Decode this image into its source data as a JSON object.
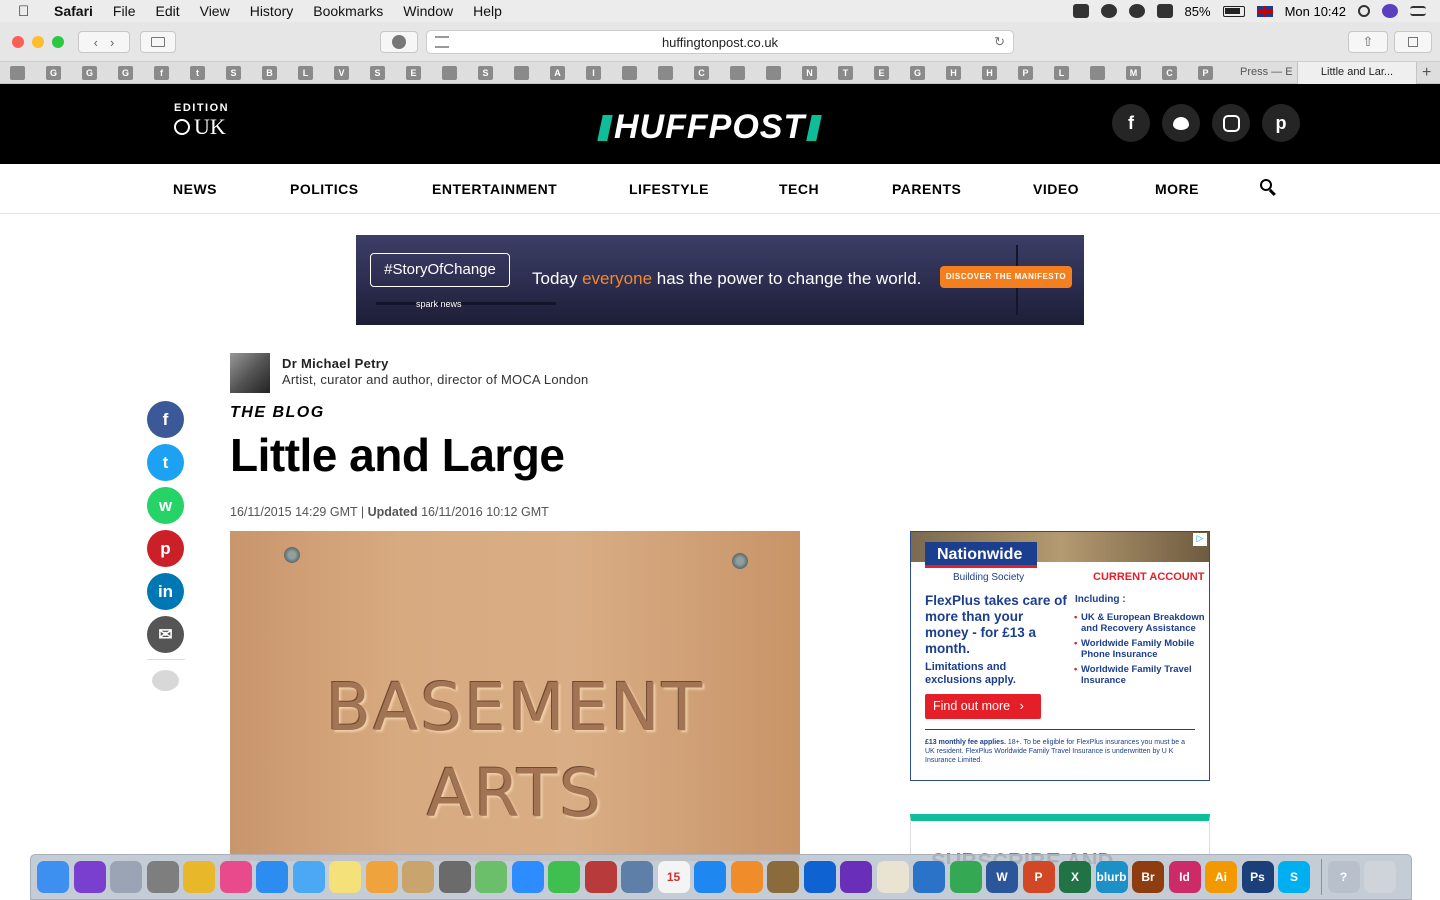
{
  "menubar": {
    "apple": "",
    "app": "Safari",
    "items": [
      "File",
      "Edit",
      "View",
      "History",
      "Bookmarks",
      "Window",
      "Help"
    ],
    "battery": "85%",
    "clock": "Mon 10:42"
  },
  "browser": {
    "url": "huffingtonpost.co.uk",
    "favorites": [
      "",
      "G",
      "G",
      "G",
      "f",
      "t",
      "S",
      "B",
      "L",
      "V",
      "S",
      "E",
      "",
      "S",
      "",
      "A",
      "I",
      "",
      "",
      "C",
      "",
      "",
      "N",
      "T",
      "E",
      "G",
      "H",
      "H",
      "P",
      "L",
      "",
      "M",
      "C",
      "P"
    ],
    "tabs": [
      {
        "label": "Press — E",
        "active": false
      },
      {
        "label": "Little and Lar...",
        "active": true
      }
    ],
    "new_tab": "+"
  },
  "site": {
    "edition_label": "EDITION",
    "edition_region": "UK",
    "logo": "HUFFPOST",
    "social": [
      "f",
      "t",
      "ig",
      "p"
    ],
    "nav": [
      "NEWS",
      "POLITICS",
      "ENTERTAINMENT",
      "LIFESTYLE",
      "TECH",
      "PARENTS",
      "VIDEO",
      "MORE"
    ]
  },
  "banner_ad": {
    "hashtag": "#StoryOfChange",
    "sponsor": "spark news",
    "headline_before": "Today ",
    "headline_highlight": "everyone",
    "headline_after": " has the power to change the world.",
    "cta": "DISCOVER THE MANIFESTO"
  },
  "article": {
    "author_name": "Dr Michael Petry",
    "author_bio": "Artist, curator and author, director of MOCA London",
    "section": "THE BLOG",
    "title": "Little and Large",
    "published": "16/11/2015 14:29 GMT",
    "separator": "|",
    "updated_label": "Updated",
    "updated": "16/11/2016 10:12 GMT",
    "image_text_line1": "BASEMENT",
    "image_text_line2": "ARTS"
  },
  "share_rail": [
    {
      "name": "facebook",
      "glyph": "f",
      "color": "#3b5998"
    },
    {
      "name": "twitter",
      "glyph": "t",
      "color": "#1da1f2"
    },
    {
      "name": "whatsapp",
      "glyph": "w",
      "color": "#25d366"
    },
    {
      "name": "pinterest",
      "glyph": "p",
      "color": "#cb2027"
    },
    {
      "name": "linkedin",
      "glyph": "in",
      "color": "#0077b5"
    },
    {
      "name": "email",
      "glyph": "✉",
      "color": "#555555"
    }
  ],
  "side_ad": {
    "brand": "Nationwide",
    "brand_sub": "Building Society",
    "product": "CURRENT ACCOUNT",
    "offer": "FlexPlus takes care of more than your money - for £13 a month.",
    "limits": "Limitations and exclusions apply.",
    "including": "Including :",
    "benefits": [
      "UK & European Breakdown and Recovery Assistance",
      "Worldwide Family Mobile Phone Insurance",
      "Worldwide Family Travel Insurance"
    ],
    "button": "Find out more",
    "fine_bold": "£13 monthly fee applies.",
    "fine_print": "18+. To be eligible for FlexPlus insurances you must be a UK resident. FlexPlus Worldwide Family Travel Insurance is underwritten by U K Insurance Limited."
  },
  "subscribe": {
    "title": "SUBSCRIBE AND"
  },
  "dock": [
    {
      "name": "finder",
      "color": "#3d8ff0"
    },
    {
      "name": "siri",
      "color": "#7b3fd0"
    },
    {
      "name": "launchpad",
      "color": "#9aa4b5"
    },
    {
      "name": "system-preferences",
      "color": "#7e7e7e"
    },
    {
      "name": "chrome",
      "color": "#e9b72a"
    },
    {
      "name": "itunes",
      "color": "#e84a8b"
    },
    {
      "name": "safari",
      "color": "#2d8cf0"
    },
    {
      "name": "messages",
      "color": "#4aa8f5"
    },
    {
      "name": "notes",
      "color": "#f5e17a"
    },
    {
      "name": "photos",
      "color": "#f0a33c"
    },
    {
      "name": "contacts",
      "color": "#c9a46c"
    },
    {
      "name": "calculator",
      "color": "#6b6b6b"
    },
    {
      "name": "maps",
      "color": "#6cbf6a"
    },
    {
      "name": "zoom",
      "color": "#2d8cff"
    },
    {
      "name": "facetime",
      "color": "#3fbf4f"
    },
    {
      "name": "photo-booth",
      "color": "#b83a3a"
    },
    {
      "name": "preview",
      "color": "#5d7fa8"
    },
    {
      "name": "calendar",
      "color": "#f4f4f4"
    },
    {
      "name": "app-store",
      "color": "#1e88f0"
    },
    {
      "name": "ibooks",
      "color": "#f08c2a"
    },
    {
      "name": "garageband",
      "color": "#8b6a3c"
    },
    {
      "name": "dropbox",
      "color": "#0f62d1"
    },
    {
      "name": "imovie",
      "color": "#6a2fb8"
    },
    {
      "name": "textedit",
      "color": "#e9e3d2"
    },
    {
      "name": "keynote",
      "color": "#2b73c9"
    },
    {
      "name": "numbers",
      "color": "#34a853"
    },
    {
      "name": "word",
      "color": "#2b579a"
    },
    {
      "name": "powerpoint",
      "color": "#d24726"
    },
    {
      "name": "excel",
      "color": "#217346"
    },
    {
      "name": "blurb",
      "color": "#1e90c8"
    },
    {
      "name": "bridge",
      "color": "#8e3d10"
    },
    {
      "name": "indesign",
      "color": "#cc2b68"
    },
    {
      "name": "illustrator",
      "color": "#f29900"
    },
    {
      "name": "photoshop",
      "color": "#1b3f78"
    },
    {
      "name": "skype",
      "color": "#00aff0"
    },
    {
      "name": "help",
      "color": "#b8c0cc"
    },
    {
      "name": "trash",
      "color": "#cfd4da"
    }
  ],
  "dock_labels": {
    "bridge": "Br",
    "indesign": "Id",
    "illustrator": "Ai",
    "photoshop": "Ps",
    "blurb": "blurb",
    "word": "W",
    "powerpoint": "P",
    "excel": "X",
    "calendar": "15",
    "help": "?",
    "skype": "S"
  }
}
